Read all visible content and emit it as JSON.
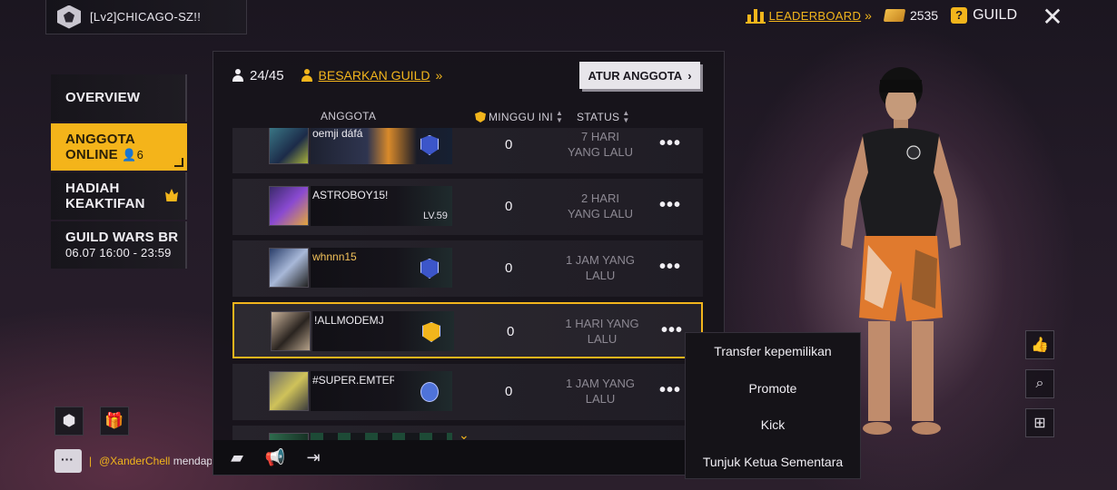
{
  "header": {
    "profile_name": "[Lv2]CHICAGO-SZ!!",
    "leaderboard_label": "LEADERBOARD",
    "coins": "2535",
    "guild_label": "GUILD"
  },
  "nav": {
    "overview": "OVERVIEW",
    "online_line1": "ANGGOTA",
    "online_line2": "ONLINE",
    "online_count": "6",
    "reward_line1": "HADIAH",
    "reward_line2": "KEAKTIFAN",
    "wars_line1": "GUILD WARS BR",
    "wars_line2": "06.07 16:00 - 23:59"
  },
  "chat": {
    "user": "@XanderChell",
    "message": " mendapat"
  },
  "panel": {
    "member_count": "24/45",
    "enlarge_label": "BESARKAN GUILD",
    "manage_button": "ATUR ANGGOTA",
    "col_member": "ANGGOTA",
    "col_week": "MINGGU INI",
    "col_status": "STATUS"
  },
  "members": [
    {
      "name": "oemji   dáfá",
      "week": "0",
      "status_line1": "7 HARI",
      "status_line2": "YANG LALU",
      "level": ""
    },
    {
      "name": "ASTROBOY15!",
      "week": "0",
      "status_line1": "2 HARI",
      "status_line2": "YANG LALU",
      "level": "LV.59"
    },
    {
      "name": "whnnn15",
      "week": "0",
      "status_line1": "1 JAM YANG",
      "status_line2": "LALU",
      "level": ""
    },
    {
      "name": "!ALLMODEMJ",
      "week": "0",
      "status_line1": "1 HARI YANG",
      "status_line2": "LALU",
      "level": ""
    },
    {
      "name": "#SUPER.EMTER",
      "week": "0",
      "status_line1": "1 JAM YANG",
      "status_line2": "LALU",
      "level": ""
    }
  ],
  "context_menu": {
    "transfer": "Transfer kepemilikan",
    "promote": "Promote",
    "kick": "Kick",
    "temp_leader": "Tunjuk Ketua Sementara"
  },
  "icons": {
    "accent": "#f2b51c",
    "side": [
      "thumbs-up-icon",
      "report-icon",
      "gift-icon"
    ]
  }
}
